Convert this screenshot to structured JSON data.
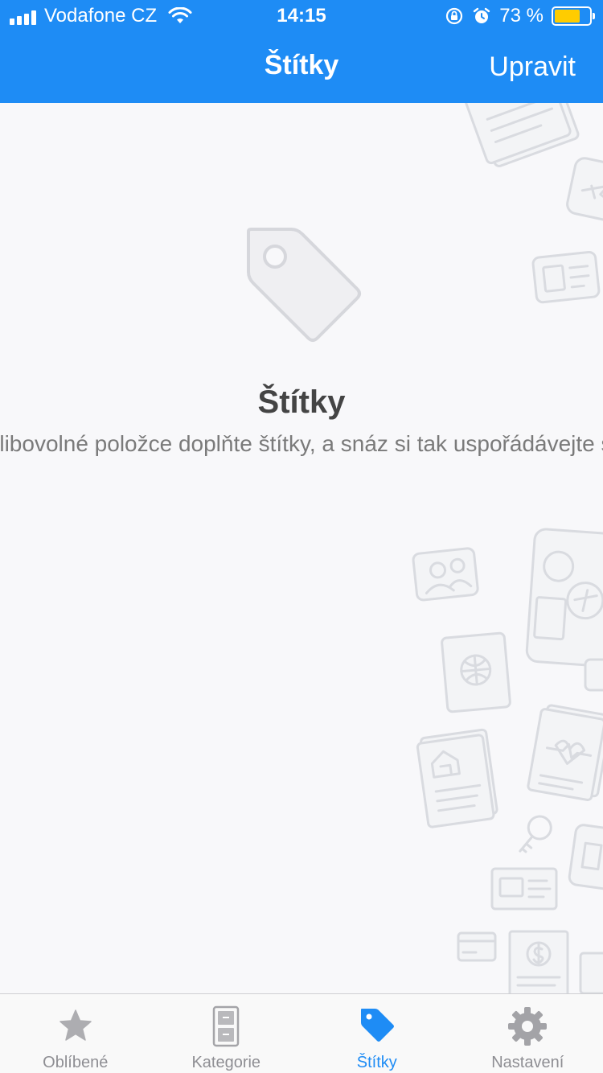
{
  "status_bar": {
    "carrier": "Vodafone CZ",
    "time": "14:15",
    "battery": "73 %",
    "battery_level": 0.73,
    "icons": [
      "signal-icon",
      "wifi-icon",
      "rotation-lock-icon",
      "alarm-icon",
      "battery-icon"
    ]
  },
  "nav": {
    "title": "Štítky",
    "edit_label": "Upravit"
  },
  "empty_state": {
    "icon": "tag-icon",
    "title": "Štítky",
    "description": "Ke každé libovolné položce doplňte štítky, a snáz si tak uspořádávejte své údaje."
  },
  "tabbar": {
    "items": [
      {
        "label": "Oblíbené",
        "icon": "star-icon",
        "active": false
      },
      {
        "label": "Kategorie",
        "icon": "cabinet-icon",
        "active": false
      },
      {
        "label": "Štítky",
        "icon": "tag-icon",
        "active": true
      },
      {
        "label": "Nastavení",
        "icon": "gear-icon",
        "active": false
      }
    ]
  },
  "colors": {
    "accent": "#1e8cf5",
    "background": "#f8f8fa",
    "battery_fill": "#ffcc00",
    "inactive_tab": "#8e8e93",
    "title_text": "#444444",
    "desc_text": "#7a7a7a"
  }
}
